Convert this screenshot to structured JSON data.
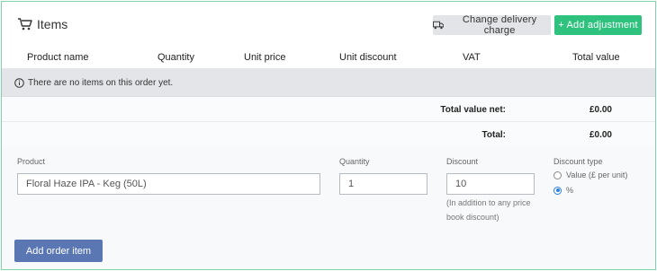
{
  "header": {
    "title": "Items",
    "change_delivery_label": "Change delivery charge",
    "add_adjustment_label": "+ Add adjustment"
  },
  "table": {
    "columns": [
      "Product name",
      "Quantity",
      "Unit price",
      "Unit discount",
      "VAT",
      "Total value"
    ],
    "empty_message": "There are no items on this order yet.",
    "totals": [
      {
        "label": "Total value net:",
        "value": "£0.00"
      },
      {
        "label": "Total:",
        "value": "£0.00"
      }
    ]
  },
  "form": {
    "product_label": "Product",
    "product_value": "Floral Haze IPA - Keg (50L)",
    "quantity_label": "Quantity",
    "quantity_value": "1",
    "discount_label": "Discount",
    "discount_value": "10",
    "discount_hint_line1": "(In addition to any price",
    "discount_hint_line2": "book discount)",
    "discount_type_label": "Discount type",
    "discount_type_options": [
      {
        "label": "Value (£ per unit)",
        "checked": false
      },
      {
        "label": "%",
        "checked": true
      }
    ],
    "add_button_label": "Add order item"
  },
  "colors": {
    "panel_border": "#7fd3a8",
    "add_adjustment_bg": "#2ec27e",
    "add_order_item_bg": "#5a77b3",
    "radio_selected": "#2a7de1"
  },
  "icons": [
    "cart-icon",
    "truck-icon",
    "info-icon"
  ]
}
